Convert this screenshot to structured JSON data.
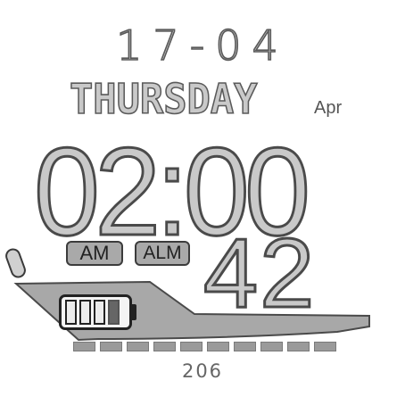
{
  "watchface": {
    "date": "17-04",
    "weekday": "THURSDAY",
    "month": "Apr",
    "time": "02:00",
    "seconds": "42",
    "ampm": "AM",
    "alarm_label": "ALM",
    "steps": "206",
    "battery_cells_full": 3,
    "battery_cells_total": 4,
    "step_segments_total": 10
  },
  "colors": {
    "digit_fill": "#c9c9c9",
    "digit_outline": "#5a5a5a",
    "badge_fill": "#a9a9a9",
    "swoosh_fill": "#a8a8a8"
  }
}
